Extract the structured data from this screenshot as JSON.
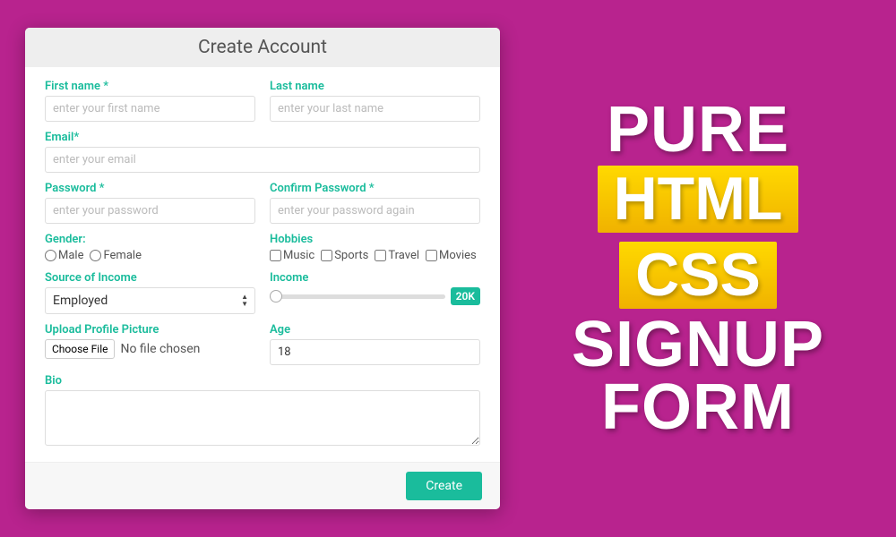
{
  "form": {
    "title": "Create Account",
    "firstName": {
      "label": "First name *",
      "placeholder": "enter your first name"
    },
    "lastName": {
      "label": "Last name",
      "placeholder": "enter your last name"
    },
    "email": {
      "label": "Email*",
      "placeholder": "enter your email"
    },
    "password": {
      "label": "Password *",
      "placeholder": "enter your password"
    },
    "confirmPassword": {
      "label": "Confirm Password *",
      "placeholder": "enter your password again"
    },
    "gender": {
      "label": "Gender:",
      "options": [
        "Male",
        "Female"
      ]
    },
    "hobbies": {
      "label": "Hobbies",
      "options": [
        "Music",
        "Sports",
        "Travel",
        "Movies"
      ]
    },
    "sourceOfIncome": {
      "label": "Source of Income",
      "value": "Employed"
    },
    "income": {
      "label": "Income",
      "valueDisplay": "20K"
    },
    "uploadPicture": {
      "label": "Upload Profile Picture",
      "buttonLabel": "Choose File",
      "statusText": "No file chosen"
    },
    "age": {
      "label": "Age",
      "value": "18"
    },
    "bio": {
      "label": "Bio"
    },
    "submitLabel": "Create"
  },
  "promo": {
    "line1": "PURE",
    "badge1": "HTML",
    "badge2": "CSS",
    "line2": "SIGNUP",
    "line3": "FORM"
  }
}
